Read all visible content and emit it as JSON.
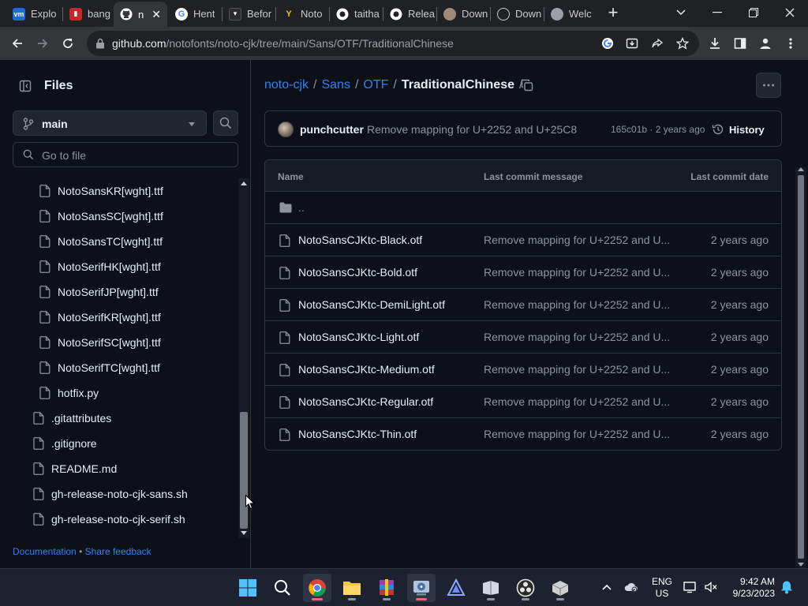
{
  "browser": {
    "tabs": [
      {
        "title": "Explo",
        "icon": "vmware-icon",
        "color": "#1d6ad8"
      },
      {
        "title": "bang",
        "icon": "red-doc-icon",
        "color": "#c62828"
      },
      {
        "title": "n",
        "icon": "github-icon",
        "color": "#ffffff",
        "active": true
      },
      {
        "title": "Hent",
        "icon": "google-icon",
        "color": "#4285f4"
      },
      {
        "title": "Befor",
        "icon": "shield-icon",
        "color": "#333333"
      },
      {
        "title": "Noto",
        "icon": "google-fonts-icon",
        "color": "#fbbc04"
      },
      {
        "title": "taitha",
        "icon": "github-icon",
        "color": "#ffffff"
      },
      {
        "title": "Relea",
        "icon": "github-icon",
        "color": "#ffffff"
      },
      {
        "title": "Down",
        "icon": "download-site-icon",
        "color": "#a0887a"
      },
      {
        "title": "Down",
        "icon": "openai-icon",
        "color": "#cccccc"
      },
      {
        "title": "Welc",
        "icon": "globe-icon",
        "color": "#9aa0a6"
      }
    ],
    "url_host": "github.com",
    "url_path": "/notofonts/noto-cjk/tree/main/Sans/OTF/TraditionalChinese"
  },
  "sidebar": {
    "title": "Files",
    "branch": "main",
    "goto_placeholder": "Go to file",
    "tree": [
      {
        "name": "NotoSansKR[wght].ttf",
        "level": 2
      },
      {
        "name": "NotoSansSC[wght].ttf",
        "level": 2
      },
      {
        "name": "NotoSansTC[wght].ttf",
        "level": 2
      },
      {
        "name": "NotoSerifHK[wght].ttf",
        "level": 2
      },
      {
        "name": "NotoSerifJP[wght].ttf",
        "level": 2
      },
      {
        "name": "NotoSerifKR[wght].ttf",
        "level": 2
      },
      {
        "name": "NotoSerifSC[wght].ttf",
        "level": 2
      },
      {
        "name": "NotoSerifTC[wght].ttf",
        "level": 2
      },
      {
        "name": "hotfix.py",
        "level": 2
      },
      {
        "name": ".gitattributes",
        "level": 1
      },
      {
        "name": ".gitignore",
        "level": 1
      },
      {
        "name": "README.md",
        "level": 1
      },
      {
        "name": "gh-release-noto-cjk-sans.sh",
        "level": 1
      },
      {
        "name": "gh-release-noto-cjk-serif.sh",
        "level": 1
      }
    ],
    "footer_doc": "Documentation",
    "footer_sep": "•",
    "footer_feedback": "Share feedback"
  },
  "breadcrumb": {
    "repo": "noto-cjk",
    "p1": "Sans",
    "p2": "OTF",
    "current": "TraditionalChinese",
    "sep": "/"
  },
  "commit": {
    "author": "punchcutter",
    "message": "Remove mapping for U+2252 and U+25C8",
    "meta": "165c01b · 2 years ago",
    "history": "History"
  },
  "table": {
    "col_name": "Name",
    "col_msg": "Last commit message",
    "col_date": "Last commit date",
    "parent": "..",
    "rows": [
      {
        "name": "NotoSansCJKtc-Black.otf",
        "msg": "Remove mapping for U+2252 and U...",
        "date": "2 years ago"
      },
      {
        "name": "NotoSansCJKtc-Bold.otf",
        "msg": "Remove mapping for U+2252 and U...",
        "date": "2 years ago"
      },
      {
        "name": "NotoSansCJKtc-DemiLight.otf",
        "msg": "Remove mapping for U+2252 and U...",
        "date": "2 years ago"
      },
      {
        "name": "NotoSansCJKtc-Light.otf",
        "msg": "Remove mapping for U+2252 and U...",
        "date": "2 years ago"
      },
      {
        "name": "NotoSansCJKtc-Medium.otf",
        "msg": "Remove mapping for U+2252 and U...",
        "date": "2 years ago"
      },
      {
        "name": "NotoSansCJKtc-Regular.otf",
        "msg": "Remove mapping for U+2252 and U...",
        "date": "2 years ago"
      },
      {
        "name": "NotoSansCJKtc-Thin.otf",
        "msg": "Remove mapping for U+2252 and U...",
        "date": "2 years ago"
      }
    ]
  },
  "taskbar": {
    "lang1": "ENG",
    "lang2": "US",
    "time": "9:42 AM",
    "date": "9/23/2023"
  }
}
